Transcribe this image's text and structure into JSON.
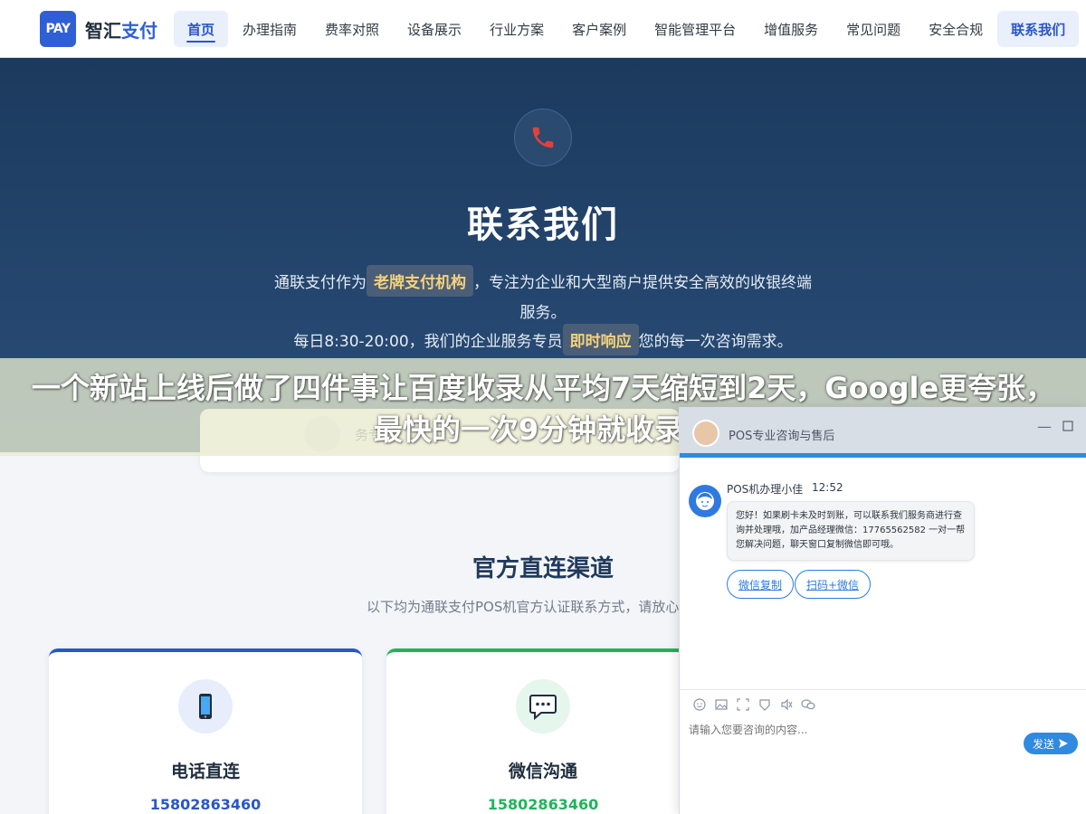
{
  "header": {
    "logo_text": "PAY",
    "brand_part1": "智汇",
    "brand_part2": "支付",
    "nav": [
      "首页",
      "办理指南",
      "费率对照",
      "设备展示",
      "行业方案",
      "客户案例",
      "智能管理平台",
      "增值服务",
      "常见问题",
      "安全合规",
      "联系我们"
    ]
  },
  "hero": {
    "title": "联系我们",
    "line1_pre": "通联支付作为",
    "line1_highlight": "老牌支付机构",
    "line1_post": "，专注为企业和大型商户提供安全高效的收银终端",
    "line2": "服务。",
    "line3_pre": "每日8:30-20:00，我们的企业服务专员",
    "line3_highlight": "即时响应",
    "line3_post": "您的每一次咨询需求。"
  },
  "overlay_banner": {
    "text": "一个新站上线后做了四件事让百度收录从平均7天缩短到2天，Google更夸张，最快的一次9分钟就收录了"
  },
  "under_card": {
    "text": "务专"
  },
  "section": {
    "title": "官方直连渠道",
    "subtitle": "以下均为通联支付POS机官方认证联系方式，请放心"
  },
  "cards": [
    {
      "title": "电话直连",
      "phone": "15802863460",
      "icon": "phone-icon"
    },
    {
      "title": "微信沟通",
      "phone": "15802863460",
      "icon": "chat-icon"
    }
  ],
  "chat": {
    "header_title": "POS专业咨询与售后",
    "agent_name": "POS机办理小佳",
    "time": "12:52",
    "message": "您好！如果刷卡未及时到账，可以联系我们服务商进行查询并处理哦，加产品经理微信：17765562582 一对一帮您解决问题，聊天窗口复制微信即可哦。",
    "quick_buttons": [
      "微信复制",
      "扫码+微信"
    ],
    "input_placeholder": "请输入您要咨询的内容...",
    "send_label": "发送"
  },
  "colors": {
    "primary": "#2a56c6",
    "green": "#21b35c",
    "hero_bg": "#1c3a5e",
    "highlight_text": "#f5d27a",
    "chat_blue": "#2f8ae0"
  }
}
